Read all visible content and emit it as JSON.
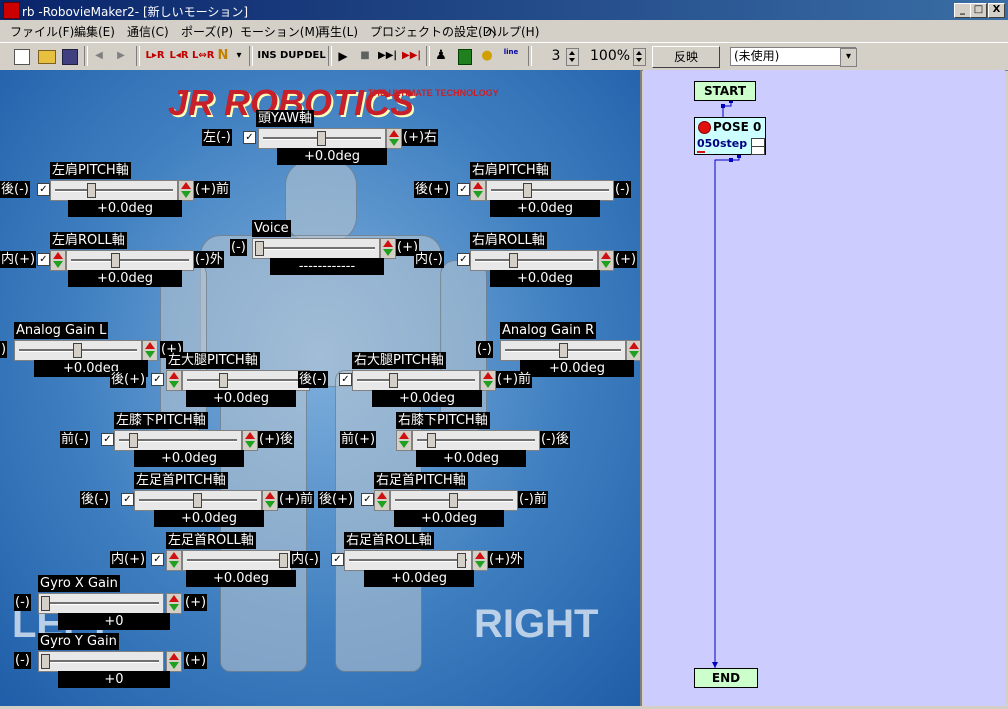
{
  "window": {
    "title": "rb -RobovieMaker2-  [新しいモーション]",
    "min": "_",
    "max": "□",
    "close": "X"
  },
  "menu": [
    "ファイル(F)",
    "編集(E)",
    "通信(C)",
    "ポーズ(P)",
    "モーション(M)",
    "再生(L)",
    "プロジェクトの設定(D)",
    "ヘルプ(H)"
  ],
  "toolbar": {
    "mirror_lr": "L▸R",
    "mirror_rl": "L◂R",
    "swap": "L⇔R",
    "n_label": "N",
    "ins": "INS",
    "dup": "DUP",
    "del": "DEL",
    "line": "line",
    "count_value": "3",
    "zoom_value": "100%",
    "reflect_button": "反映",
    "unused_select": "(未使用)"
  },
  "logo": {
    "main": "JR ROBOTICS",
    "sub": "THE ULTIMATE TECHNOLOGY"
  },
  "sides": {
    "left": "LEFT",
    "right": "RIGHT"
  },
  "controls": {
    "head_yaw": {
      "title": "頭YAW軸",
      "left": "左(-)",
      "right": "(+)右",
      "value": "+0.0deg",
      "checked": "✓"
    },
    "l_shoulder_pitch": {
      "title": "左肩PITCH軸",
      "left": "後(-)",
      "right": "(+)前",
      "value": "+0.0deg",
      "checked": "✓"
    },
    "r_shoulder_pitch": {
      "title": "右肩PITCH軸",
      "left": "後(+)",
      "right": "(-)",
      "value": "+0.0deg",
      "checked": "✓"
    },
    "l_shoulder_roll": {
      "title": "左肩ROLL軸",
      "left": "内(+)",
      "right": "(-)外",
      "value": "+0.0deg",
      "checked": "✓"
    },
    "voice": {
      "title": "Voice",
      "left": "(-)",
      "right": "(+)",
      "value": "------------"
    },
    "r_shoulder_roll": {
      "title": "右肩ROLL軸",
      "left": "内(-)",
      "right": "(+)",
      "value": "+0.0deg",
      "checked": "✓"
    },
    "analog_gain_l": {
      "title": "Analog Gain L",
      "left": ")",
      "right": "(+)",
      "value": "+0.0deg"
    },
    "analog_gain_r": {
      "title": "Analog Gain R",
      "left": "(-)",
      "right": "",
      "value": "+0.0deg"
    },
    "l_thigh_pitch": {
      "title": "左大腿PITCH軸",
      "left": "後(+)",
      "right": "",
      "value": "+0.0deg",
      "checked": "✓"
    },
    "r_thigh_pitch": {
      "title": "右大腿PITCH軸",
      "left": "後(-)",
      "right": "(+)前",
      "value": "+0.0deg",
      "checked": "✓"
    },
    "l_knee_pitch": {
      "title": "左膝下PITCH軸",
      "left": "前(-)",
      "right": "(+)後",
      "value": "+0.0deg",
      "checked": "✓"
    },
    "r_knee_pitch": {
      "title": "右膝下PITCH軸",
      "left": "前(+)",
      "right": "(-)後",
      "value": "+0.0deg",
      "checked": "✓"
    },
    "l_ankle_pitch": {
      "title": "左足首PITCH軸",
      "left": "後(-)",
      "right": "(+)前",
      "value": "+0.0deg",
      "checked": "✓"
    },
    "r_ankle_pitch": {
      "title": "右足首PITCH軸",
      "left": "後(+)",
      "right": "(-)前",
      "value": "+0.0deg",
      "checked": "✓"
    },
    "l_ankle_roll": {
      "title": "左足首ROLL軸",
      "left": "内(+)",
      "right": "",
      "value": "+0.0deg",
      "checked": "✓"
    },
    "r_ankle_roll": {
      "title": "右足首ROLL軸",
      "left": "内(-)",
      "right": "(+)外",
      "value": "+0.0deg",
      "checked": "✓"
    },
    "gyro_x": {
      "title": "Gyro X Gain",
      "left": "(-)",
      "right": "(+)",
      "value": "+0"
    },
    "gyro_y": {
      "title": "Gyro Y Gain",
      "left": "(-)",
      "right": "(+)",
      "value": "+0"
    }
  },
  "flow": {
    "start": "START",
    "pose_name": "POSE 0",
    "pose_step": "050step",
    "end": "END"
  },
  "colors": {
    "accent": "#0a246a",
    "flow_bg": "#ccccff",
    "node_bg": "#ccffcc",
    "pose_bg": "#ccffff"
  }
}
